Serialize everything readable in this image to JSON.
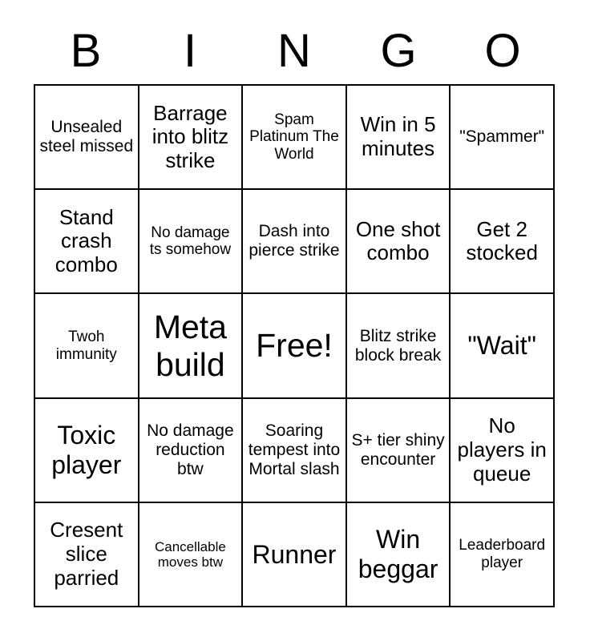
{
  "card": {
    "title_letters": [
      "B",
      "I",
      "N",
      "G",
      "O"
    ],
    "free_space_index": {
      "row": 2,
      "col": 2
    }
  },
  "grid": {
    "rows": [
      [
        {
          "text": "Unsealed steel missed",
          "size": "md"
        },
        {
          "text": "Barrage into blitz strike",
          "size": "lg"
        },
        {
          "text": "Spam Platinum The World",
          "size": "sm"
        },
        {
          "text": "Win in 5 minutes",
          "size": "lg"
        },
        {
          "text": "\"Spammer\"",
          "size": "md"
        }
      ],
      [
        {
          "text": "Stand crash combo",
          "size": "lg"
        },
        {
          "text": "No damage ts somehow",
          "size": "sm"
        },
        {
          "text": "Dash into pierce strike",
          "size": "md"
        },
        {
          "text": "One shot combo",
          "size": "lg"
        },
        {
          "text": "Get 2 stocked",
          "size": "lg"
        }
      ],
      [
        {
          "text": "Twoh immunity",
          "size": "sm"
        },
        {
          "text": "Meta build",
          "size": "xxl"
        },
        {
          "text": "Free!",
          "size": "xxl"
        },
        {
          "text": "Blitz strike block break",
          "size": "md"
        },
        {
          "text": "\"Wait\"",
          "size": "xl"
        }
      ],
      [
        {
          "text": "Toxic player",
          "size": "xl"
        },
        {
          "text": "No damage reduction btw",
          "size": "md"
        },
        {
          "text": "Soaring tempest into Mortal slash",
          "size": "md"
        },
        {
          "text": "S+ tier shiny encounter",
          "size": "md"
        },
        {
          "text": "No players in queue",
          "size": "lg"
        }
      ],
      [
        {
          "text": "Cresent slice parried",
          "size": "lg"
        },
        {
          "text": "Cancellable moves btw",
          "size": "xs"
        },
        {
          "text": "Runner",
          "size": "xl"
        },
        {
          "text": "Win beggar",
          "size": "xl"
        },
        {
          "text": "Leaderboard player",
          "size": "sm"
        }
      ]
    ]
  },
  "colors": {
    "background": "#ffffff",
    "text": "#000000",
    "grid_line": "#000000"
  }
}
